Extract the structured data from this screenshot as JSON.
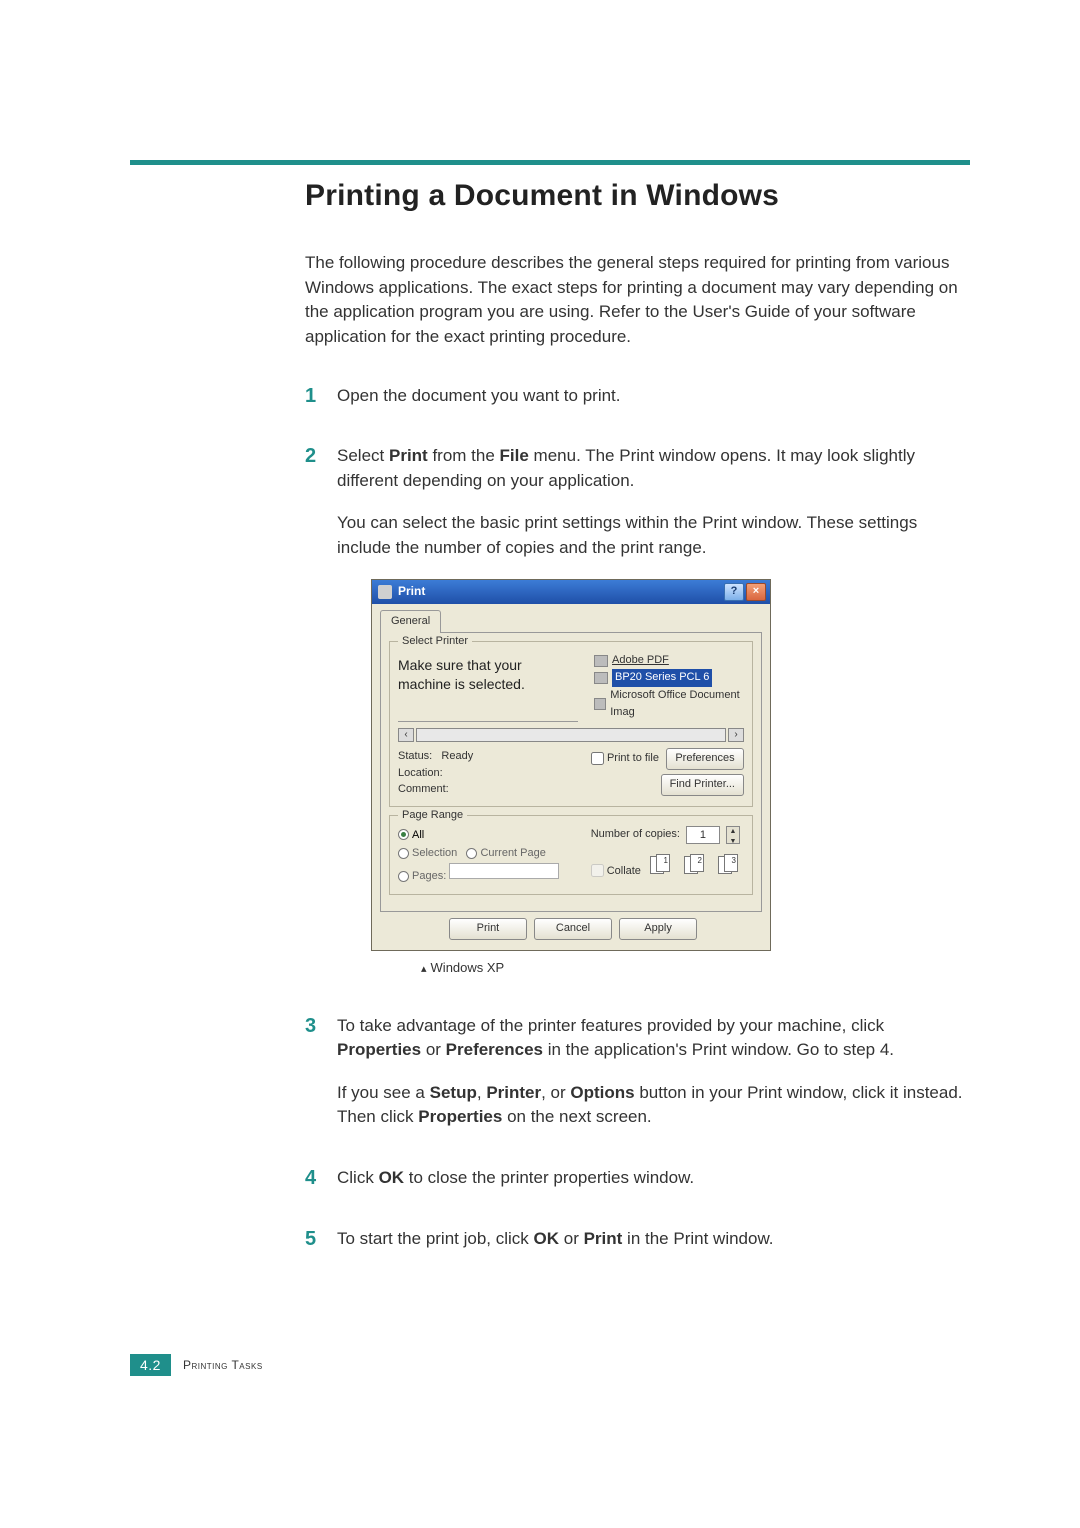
{
  "heading": "Printing a Document in Windows",
  "intro": "The following procedure describes the general steps required for printing from various Windows applications. The exact steps for printing a document may vary depending on the application program you are using. Refer to the User's Guide of your software application for the exact printing procedure.",
  "steps": {
    "s1": "Open the document you want to print.",
    "s2a_pre": "Select ",
    "s2a_b1": "Print",
    "s2a_mid": " from the ",
    "s2a_b2": "File",
    "s2a_post": " menu. The Print window opens. It may look slightly different depending on your application.",
    "s2b": "You can select the basic print settings within the Print window. These settings include the number of copies and the print range.",
    "s3a_pre": "To take advantage of the printer features provided by your machine, click ",
    "s3a_b1": "Properties",
    "s3a_mid1": " or ",
    "s3a_b2": "Preferences",
    "s3a_post": " in the application's Print window. Go to step 4.",
    "s3b_pre": "If you see a ",
    "s3b_b1": "Setup",
    "s3b_mid1": ", ",
    "s3b_b2": "Printer",
    "s3b_mid2": ", or ",
    "s3b_b3": "Options",
    "s3b_mid3": " button in your Print window, click it instead. Then click ",
    "s3b_b4": "Properties",
    "s3b_post": " on the next screen.",
    "s4_pre": "Click ",
    "s4_b1": "OK",
    "s4_post": " to close the printer properties window.",
    "s5_pre": "To start the print job, click ",
    "s5_b1": "OK",
    "s5_mid": " or ",
    "s5_b2": "Print",
    "s5_post": " in the Print window."
  },
  "dialog": {
    "title": "Print",
    "tab": "General",
    "group_printer": "Select Printer",
    "callout_line1": "Make sure that your",
    "callout_line2": "machine is selected.",
    "printers": {
      "p1": "Adobe PDF",
      "p2": "BP20 Series PCL 6",
      "p3": "Microsoft Office Document Imag"
    },
    "status_label": "Status:",
    "status_value": "Ready",
    "location_label": "Location:",
    "comment_label": "Comment:",
    "print_to_file": "Print to file",
    "preferences_btn": "Preferences",
    "find_printer_btn": "Find Printer...",
    "group_range": "Page Range",
    "range_all": "All",
    "range_selection": "Selection",
    "range_current": "Current Page",
    "range_pages": "Pages:",
    "copies_label": "Number of copies:",
    "copies_value": "1",
    "collate_label": "Collate",
    "btn_print": "Print",
    "btn_cancel": "Cancel",
    "btn_apply": "Apply"
  },
  "caption": "Windows XP",
  "footer": {
    "page_num": "4.2",
    "section": "Printing Tasks"
  }
}
